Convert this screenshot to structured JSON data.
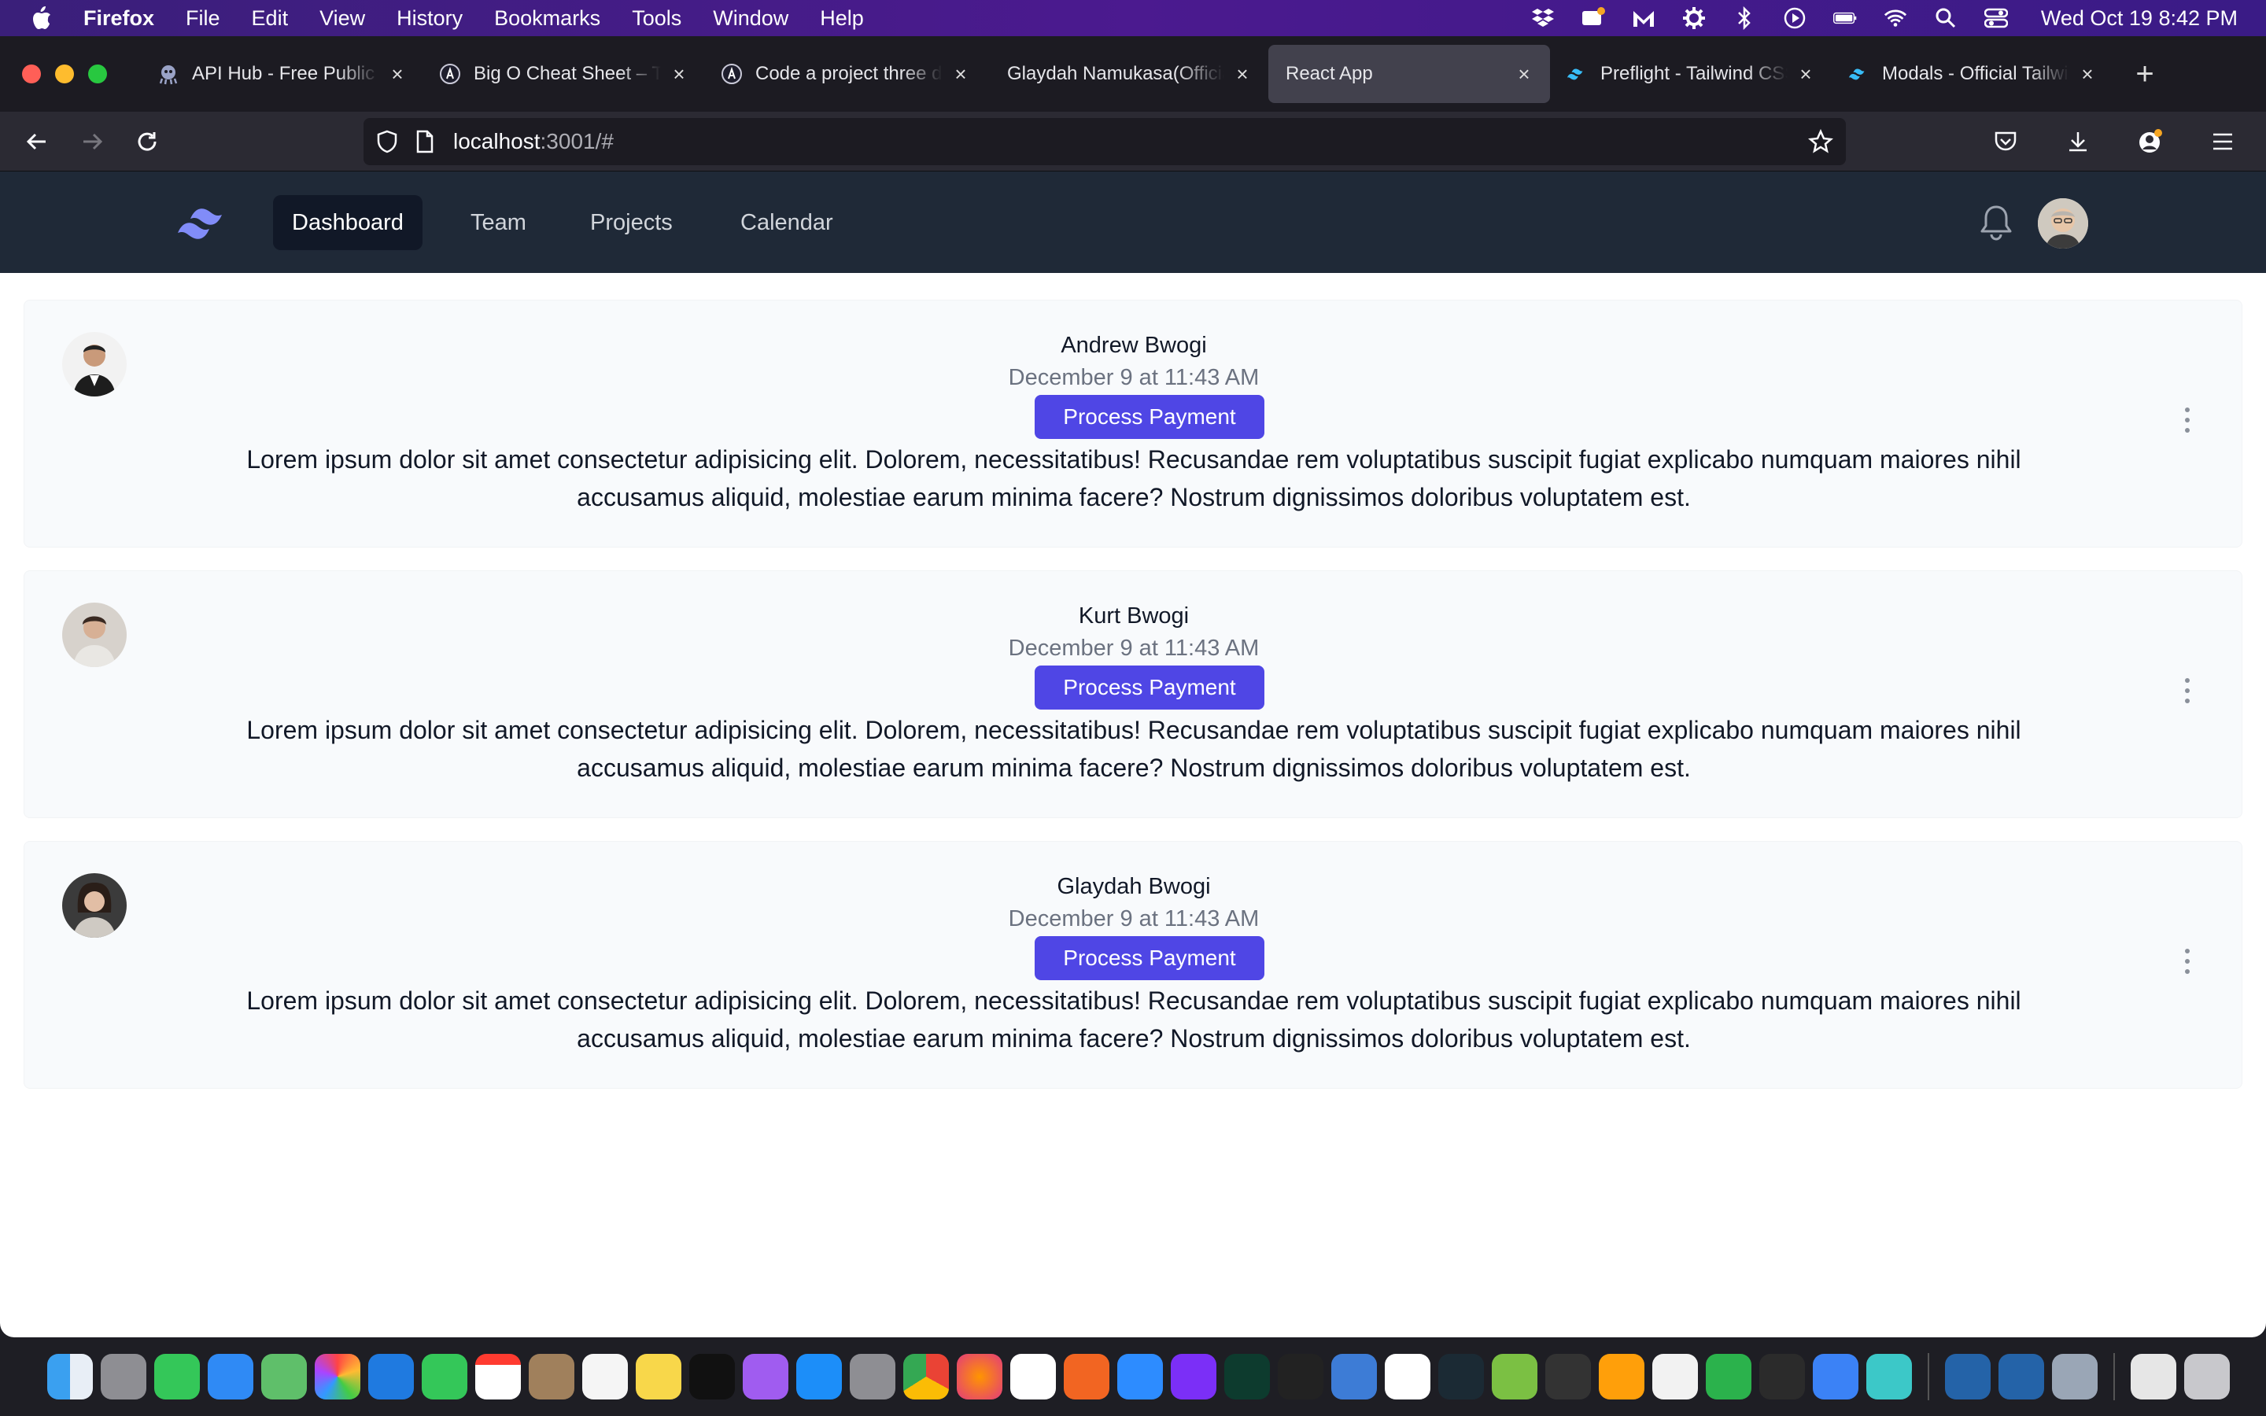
{
  "menubar": {
    "app": "Firefox",
    "items": [
      "File",
      "Edit",
      "View",
      "History",
      "Bookmarks",
      "Tools",
      "Window",
      "Help"
    ],
    "clock": "Wed Oct 19  8:42 PM",
    "status_icons": [
      "dropbox-icon",
      "notification-icon",
      "malwarebytes-icon",
      "gear-icon",
      "bluetooth-icon",
      "play-icon",
      "battery-icon",
      "wifi-icon",
      "spotlight-icon",
      "control-center-icon"
    ]
  },
  "tabs": [
    {
      "title": "API Hub - Free Public & Open",
      "icon": "octopus-icon",
      "active": false
    },
    {
      "title": "Big O Cheat Sheet – Time",
      "icon": "astro-icon",
      "active": false
    },
    {
      "title": "Code a project three different",
      "icon": "astro-icon",
      "active": false
    },
    {
      "title": "Glaydah Namukasa(Official",
      "icon": "none",
      "active": false
    },
    {
      "title": "React App",
      "icon": "none",
      "active": true
    },
    {
      "title": "Preflight - Tailwind CSS",
      "icon": "tailwind-icon",
      "active": false
    },
    {
      "title": "Modals - Official Tailwind",
      "icon": "tailwind-icon",
      "active": false
    }
  ],
  "urlbar": {
    "host": "localhost",
    "rest": ":3001/#"
  },
  "appnav": {
    "links": [
      {
        "label": "Dashboard",
        "active": true
      },
      {
        "label": "Team",
        "active": false
      },
      {
        "label": "Projects",
        "active": false
      },
      {
        "label": "Calendar",
        "active": false
      }
    ]
  },
  "posts": [
    {
      "name": "Andrew Bwogi",
      "date": "December 9 at 11:43 AM",
      "button": "Process Payment",
      "body": "Lorem ipsum dolor sit amet consectetur adipisicing elit. Dolorem, necessitatibus! Recusandae rem voluptatibus suscipit fugiat explicabo numquam maiores nihil accusamus aliquid, molestiae earum minima facere? Nostrum dignissimos doloribus voluptatem est."
    },
    {
      "name": "Kurt Bwogi",
      "date": "December 9 at 11:43 AM",
      "button": "Process Payment",
      "body": "Lorem ipsum dolor sit amet consectetur adipisicing elit. Dolorem, necessitatibus! Recusandae rem voluptatibus suscipit fugiat explicabo numquam maiores nihil accusamus aliquid, molestiae earum minima facere? Nostrum dignissimos doloribus voluptatem est."
    },
    {
      "name": "Glaydah Bwogi",
      "date": "December 9 at 11:43 AM",
      "button": "Process Payment",
      "body": "Lorem ipsum dolor sit amet consectetur adipisicing elit. Dolorem, necessitatibus! Recusandae rem voluptatibus suscipit fugiat explicabo numquam maiores nihil accusamus aliquid, molestiae earum minima facere? Nostrum dignissimos doloribus voluptatem est."
    }
  ],
  "colors": {
    "accent": "#4f46e5",
    "nav_bg": "#1f2937",
    "nav_active": "#111827",
    "card_bg": "#f8fafc"
  }
}
